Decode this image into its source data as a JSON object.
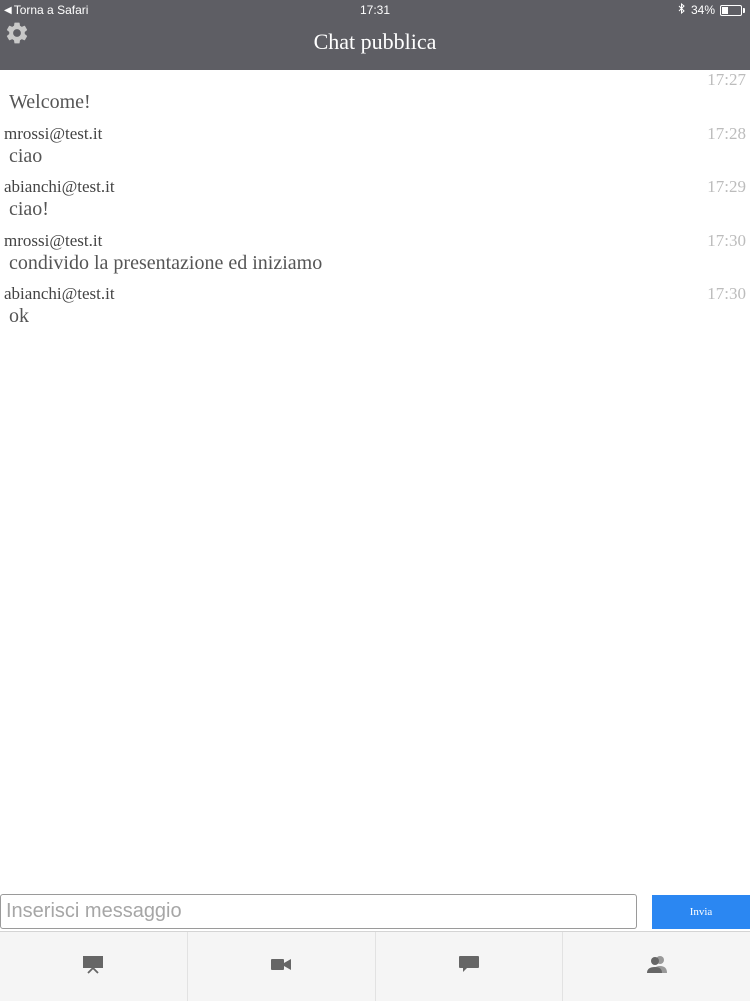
{
  "status_bar": {
    "back_label": "Torna a Safari",
    "time": "17:31",
    "battery": "34%",
    "battery_level": 0.34
  },
  "header": {
    "title": "Chat pubblica",
    "settings_icon": "gear-icon"
  },
  "messages": [
    {
      "sender": "",
      "time": "17:27",
      "text": "Welcome!"
    },
    {
      "sender": "mrossi@test.it",
      "time": "17:28",
      "text": "ciao"
    },
    {
      "sender": "abianchi@test.it",
      "time": "17:29",
      "text": "ciao!"
    },
    {
      "sender": "mrossi@test.it",
      "time": "17:30",
      "text": "condivido la presentazione ed iniziamo"
    },
    {
      "sender": "abianchi@test.it",
      "time": "17:30",
      "text": "ok"
    }
  ],
  "composer": {
    "placeholder": "Inserisci messaggio",
    "value": "",
    "send_label": "Invia"
  },
  "tabs": [
    {
      "icon": "presentation-icon"
    },
    {
      "icon": "video-camera-icon"
    },
    {
      "icon": "chat-bubble-icon"
    },
    {
      "icon": "users-icon"
    }
  ],
  "colors": {
    "header_bg": "#5e5e64",
    "send_button": "#2b87f2",
    "icon_gray": "#666666"
  }
}
